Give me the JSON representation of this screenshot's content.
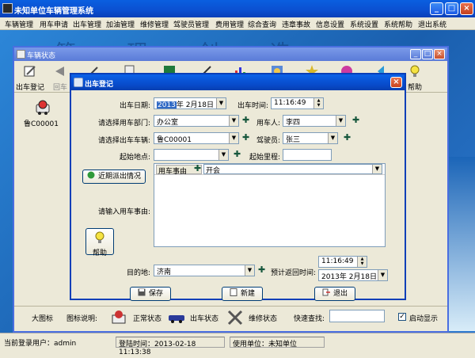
{
  "main_window": {
    "title": "未知单位车辆管理系统",
    "minimize": "_",
    "maximize": "□",
    "close": "×"
  },
  "menu": [
    "车辆管理",
    "用车申请",
    "出车管理",
    "加油管理",
    "维修管理",
    "驾驶员管理",
    "费用管理",
    "综合查询",
    "违章事故",
    "信息设置",
    "系统设置",
    "系统帮助",
    "退出系统"
  ],
  "banner": "管 理 创 造 价 值",
  "vehicle_window": {
    "title": "车辆状态",
    "minimize": "_",
    "maximize": "□",
    "close": "×",
    "toolbar": [
      {
        "label": "出车登记"
      },
      {
        "label": "回车"
      },
      {
        "label": ""
      },
      {
        "label": ""
      },
      {
        "label": ""
      },
      {
        "label": ""
      },
      {
        "label": ""
      },
      {
        "label": ""
      },
      {
        "label": ""
      },
      {
        "label": ""
      },
      {
        "label": "帮助"
      }
    ],
    "vehicle": {
      "plate": "鲁C00001"
    },
    "status": {
      "big_icon": "大图标",
      "legend": "图标说明:",
      "normal": "正常状态",
      "out": "出车状态",
      "repair": "维修状态",
      "search": "快速查找:",
      "search_value": "",
      "autoshow": "启动显示",
      "autoshow_checked": "✓"
    }
  },
  "dialog": {
    "title": "出车登记",
    "close": "×",
    "date_label": "出车日期:",
    "date_year": "2013",
    "date_rest": "年  2月18日",
    "time_label": "出车时间:",
    "time_value": "11:16:49",
    "dept_label": "请选择用车部门:",
    "dept_value": "办公室",
    "user_label": "用车人:",
    "user_value": "李四",
    "vehicle_label": "请选择出车车辆:",
    "vehicle_value": "鲁C00001",
    "driver_label": "驾驶员:",
    "driver_value": "张三",
    "start_label": "起始地点:",
    "start_value": "",
    "mileage_label": "起始里程:",
    "mileage_value": "",
    "recent_button": "近期派出情况",
    "reason_label": "请输入用车事由:",
    "reason_header": "用车事由",
    "reason_value": "开会",
    "help_button": "帮助",
    "dest_label": "目的地:",
    "dest_value": "济南",
    "return_label": "预计返回时间:",
    "return_time": "11:16:49",
    "return_date": "2013年  2月18日",
    "save": "保存",
    "new": "新建",
    "exit": "退出"
  },
  "statusbar": {
    "user": "当前登录用户：admin",
    "login_time": "登陆时间：2013-02-18 11:13:38",
    "unit": "使用单位：未知单位"
  },
  "colors": {
    "titlebar": "#0a5fe0",
    "dialog_bg": "#ece9d8",
    "close_red": "#c9431f",
    "plus_green": "#16573c"
  }
}
